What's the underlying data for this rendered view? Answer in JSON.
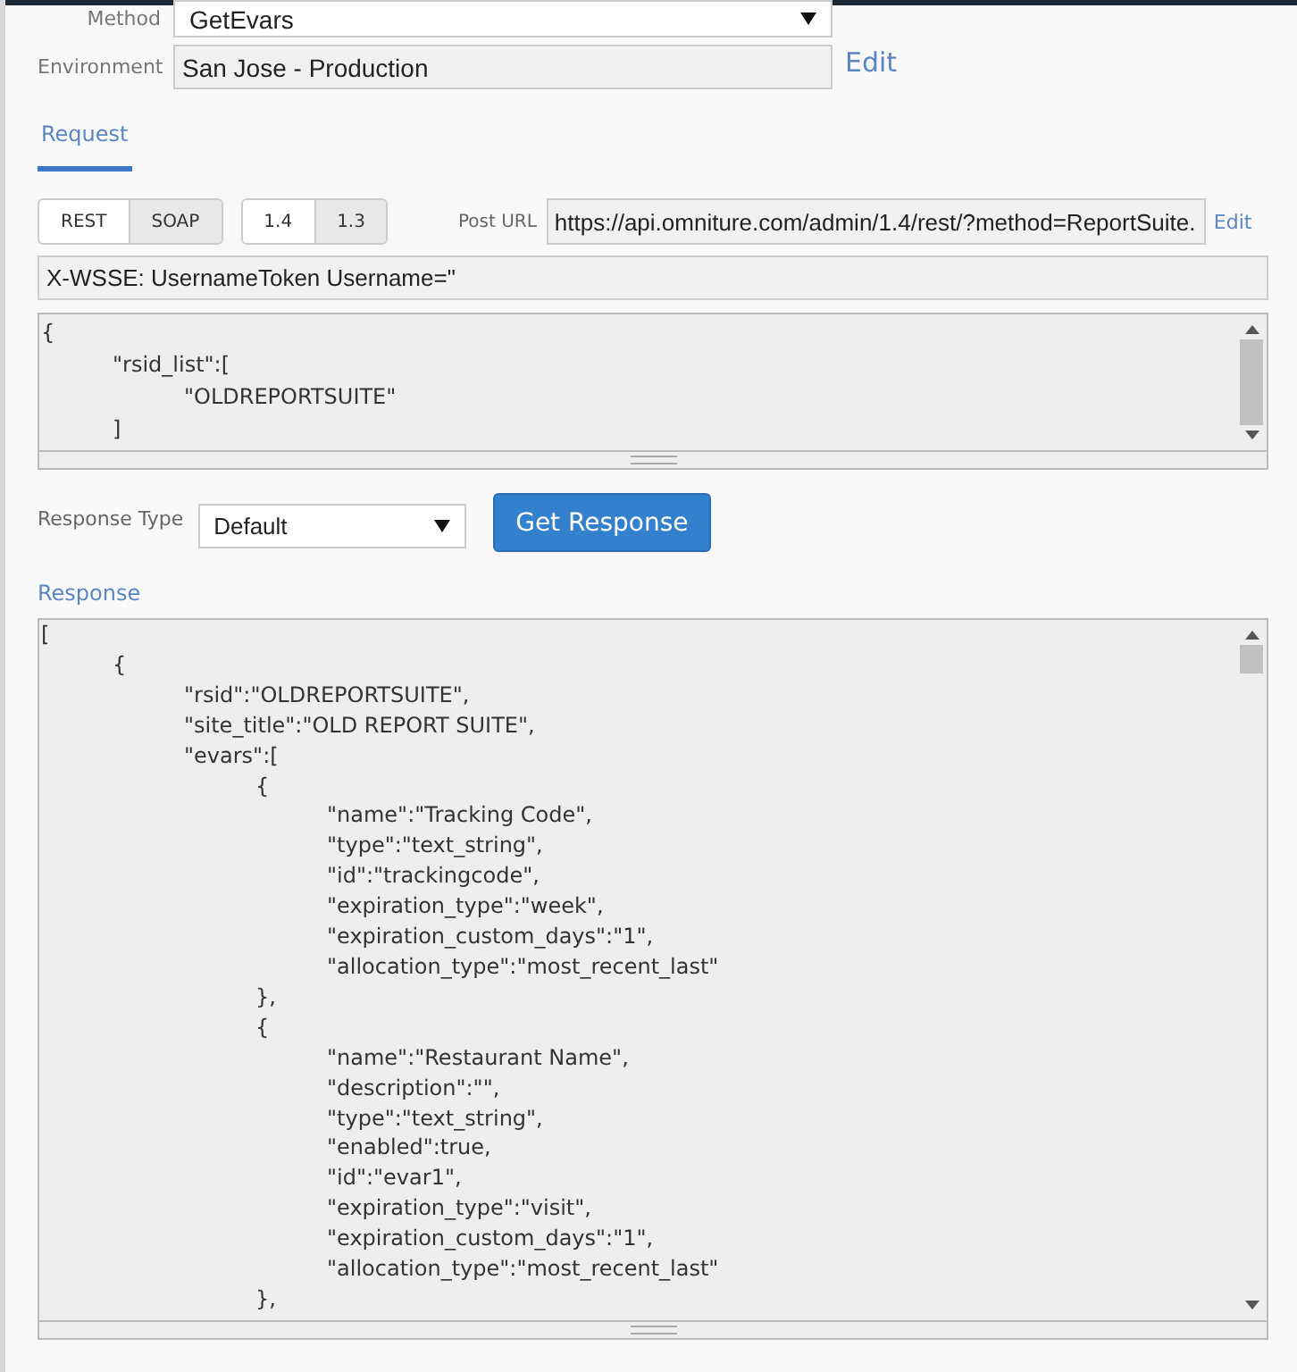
{
  "method": {
    "label": "Method",
    "value": "GetEvars"
  },
  "environment": {
    "label": "Environment",
    "value": "San Jose - Production",
    "edit_link": "Edit"
  },
  "tabs": [
    {
      "label": "Request",
      "selected": true
    }
  ],
  "format_toggle": [
    {
      "label": "REST",
      "selected": true
    },
    {
      "label": "SOAP",
      "selected": false
    }
  ],
  "version_toggle": [
    {
      "label": "1.4",
      "selected": true
    },
    {
      "label": "1.3",
      "selected": false
    }
  ],
  "post_url": {
    "label": "Post URL",
    "value": "https://api.omniture.com/admin/1.4/rest/?method=ReportSuite.",
    "edit_link": "Edit"
  },
  "header_field": {
    "value": "X-WSSE: UsernameToken Username=\""
  },
  "request_body": {
    "lines": [
      "{",
      "\t\"rsid_list\":[",
      "\t\t\"OLDREPORTSUITE\"",
      "\t]"
    ]
  },
  "response_type": {
    "label": "Response Type",
    "value": "Default"
  },
  "get_response_button": "Get Response",
  "response": {
    "label": "Response",
    "lines": [
      "[",
      "\t{",
      "\t\t\"rsid\":\"OLDREPORTSUITE\",",
      "\t\t\"site_title\":\"OLD REPORT SUITE\",",
      "\t\t\"evars\":[",
      "\t\t\t{",
      "\t\t\t\t\"name\":\"Tracking Code\",",
      "\t\t\t\t\"type\":\"text_string\",",
      "\t\t\t\t\"id\":\"trackingcode\",",
      "\t\t\t\t\"expiration_type\":\"week\",",
      "\t\t\t\t\"expiration_custom_days\":\"1\",",
      "\t\t\t\t\"allocation_type\":\"most_recent_last\"",
      "\t\t\t},",
      "\t\t\t{",
      "\t\t\t\t\"name\":\"Restaurant Name\",",
      "\t\t\t\t\"description\":\"\",",
      "\t\t\t\t\"type\":\"text_string\",",
      "\t\t\t\t\"enabled\":true,",
      "\t\t\t\t\"id\":\"evar1\",",
      "\t\t\t\t\"expiration_type\":\"visit\",",
      "\t\t\t\t\"expiration_custom_days\":\"1\",",
      "\t\t\t\t\"allocation_type\":\"most_recent_last\"",
      "\t\t\t},"
    ]
  }
}
